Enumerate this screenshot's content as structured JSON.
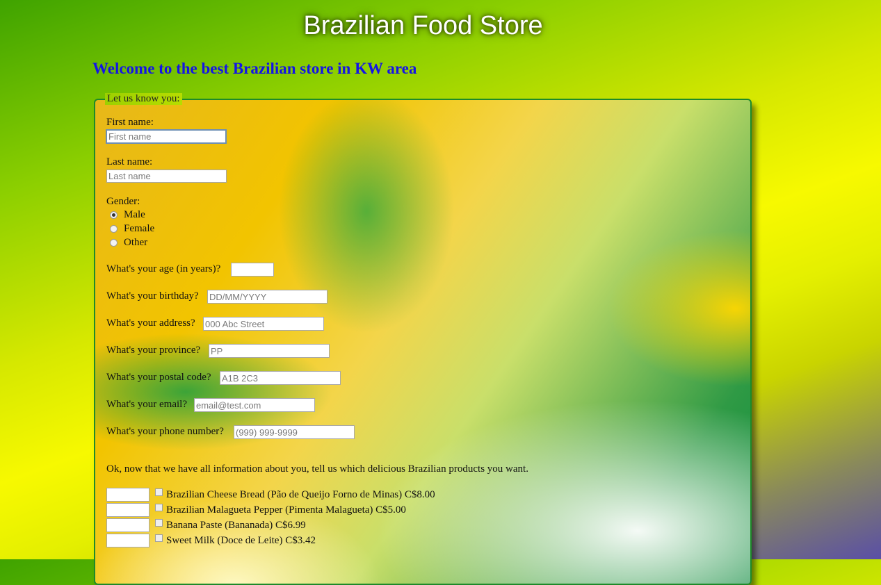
{
  "header": {
    "title": "Brazilian Food Store",
    "welcome": "Welcome to the best Brazilian store in KW area"
  },
  "form": {
    "legend": "Let us know you:",
    "first_name": {
      "label": "First name:",
      "placeholder": "First name"
    },
    "last_name": {
      "label": "Last name:",
      "placeholder": "Last name"
    },
    "gender": {
      "label": "Gender:",
      "options": [
        "Male",
        "Female",
        "Other"
      ],
      "selected": "Male"
    },
    "age": {
      "label": "What's your age (in years)?",
      "placeholder": ""
    },
    "birthday": {
      "label": "What's your birthday?",
      "placeholder": "DD/MM/YYYY"
    },
    "address": {
      "label": "What's your address?",
      "placeholder": "000 Abc Street"
    },
    "province": {
      "label": "What's your province?",
      "placeholder": "PP"
    },
    "postal": {
      "label": "What's your postal code?",
      "placeholder": "A1B 2C3"
    },
    "email": {
      "label": "What's your email?",
      "placeholder": "email@test.com"
    },
    "phone": {
      "label": "What's your phone number?",
      "placeholder": "(999) 999-9999"
    }
  },
  "products": {
    "intro": "Ok, now that we have all information about you, tell us which delicious Brazilian products you want.",
    "items": [
      {
        "label": "Brazilian Cheese Bread (Pão de Queijo Forno de Minas) C$8.00"
      },
      {
        "label": "Brazilian Malagueta Pepper (Pimenta Malagueta) C$5.00"
      },
      {
        "label": "Banana Paste (Bananada) C$6.99"
      },
      {
        "label": "Sweet Milk (Doce de Leite) C$3.42"
      }
    ]
  },
  "colors": {
    "welcome_text": "#1414e6",
    "panel_border": "#1e8a2a"
  }
}
